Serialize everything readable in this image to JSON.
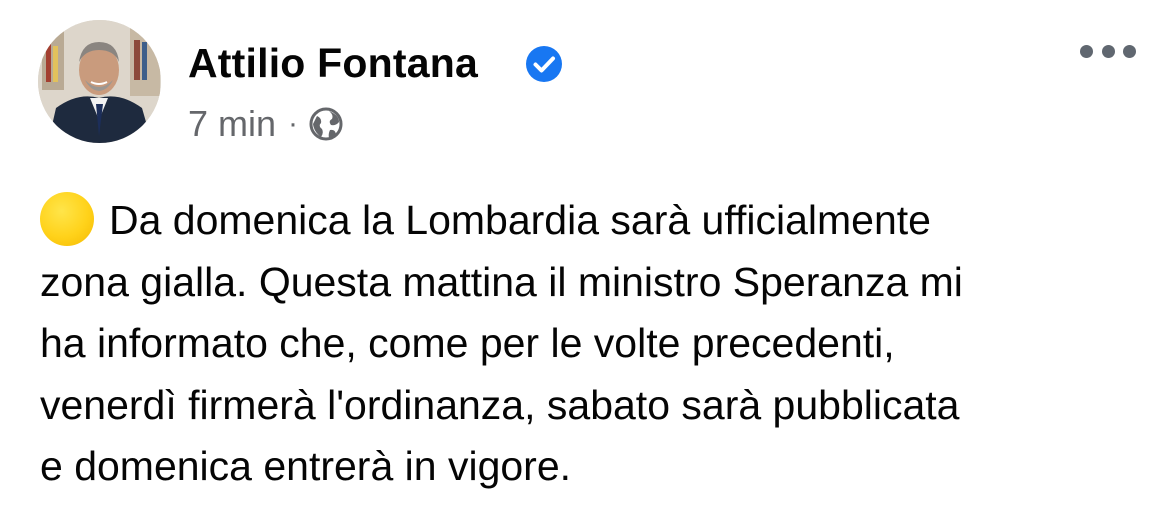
{
  "post": {
    "author": "Attilio Fontana",
    "verified_icon": "verified-badge-icon",
    "timestamp": "7 min",
    "separator": "·",
    "audience_icon": "globe-icon",
    "more_icon": "more-options-icon",
    "emoji_icon": "yellow-circle-emoji",
    "text_lines": [
      "Da domenica la Lombardia sarà ufficialmente",
      "zona gialla. Questa mattina il ministro Speranza mi",
      "ha informato che, come per le volte precedenti,",
      "venerdì firmerà l'ordinanza, sabato sarà pubblicata",
      "e domenica entrerà in vigore."
    ]
  },
  "colors": {
    "badge_blue": "#1877f2",
    "meta_gray": "#65676b",
    "emoji_yellow": "#ffd21a"
  }
}
